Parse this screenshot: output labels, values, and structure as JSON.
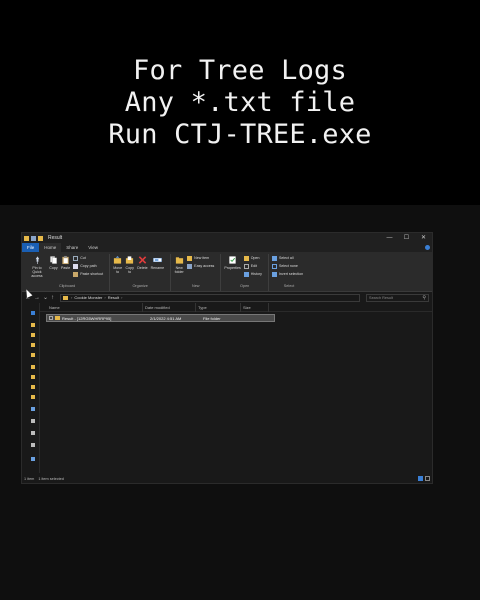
{
  "instructions": {
    "line1": "For Tree Logs",
    "line2": "Any *.txt file",
    "line3": "Run CTJ-TREE.exe"
  },
  "window": {
    "title": "Result",
    "controls": {
      "minimize": "—",
      "maximize": "☐",
      "close": "✕"
    }
  },
  "tabs": [
    "File",
    "Home",
    "Share",
    "View"
  ],
  "ribbon": {
    "clipboard": {
      "label": "Clipboard",
      "pin": "Pin to Quick access",
      "copy": "Copy",
      "paste": "Paste",
      "cut": "Cut",
      "copy_path": "Copy path",
      "paste_shortcut": "Paste shortcut"
    },
    "organize": {
      "label": "Organize",
      "move_to": "Move to",
      "copy_to": "Copy to",
      "delete": "Delete",
      "rename": "Rename"
    },
    "new": {
      "label": "New",
      "new_folder": "New folder",
      "new_item": "New item",
      "easy_access": "Easy access"
    },
    "open": {
      "label": "Open",
      "properties": "Properties",
      "open": "Open",
      "edit": "Edit",
      "history": "History"
    },
    "select": {
      "label": "Select",
      "select_all": "Select all",
      "select_none": "Select none",
      "invert_selection": "Invert selection"
    }
  },
  "address": {
    "crumbs": [
      "Cookie Monster",
      "Result"
    ],
    "search_placeholder": "Search Result"
  },
  "columns": {
    "name": "Name",
    "date": "Date modified",
    "type": "Type",
    "size": "Size"
  },
  "rows": [
    {
      "name": "Result - [12RG5WHRRP95]",
      "date": "2/1/2022 4:51 AM",
      "type": "File folder",
      "size": ""
    }
  ],
  "status": {
    "count": "1 item",
    "selected": "1 item selected"
  },
  "colors": {
    "accent": "#1a5fb4",
    "folder": "#e6b94a"
  }
}
